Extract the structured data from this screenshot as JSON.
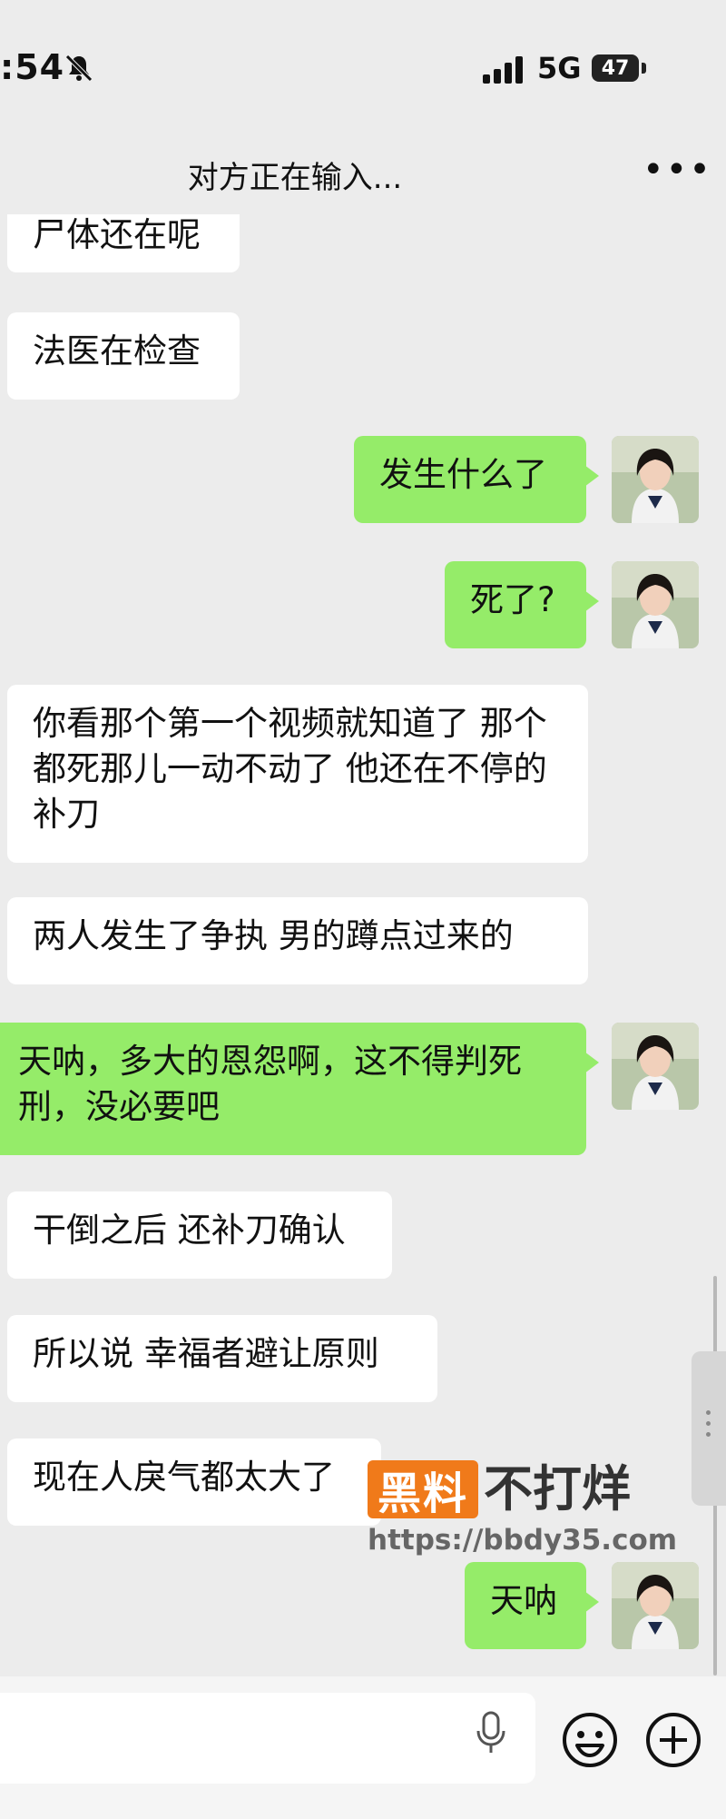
{
  "status": {
    "time": ":54",
    "network": "5G",
    "battery": "47"
  },
  "header": {
    "title": "对方正在输入...",
    "more_label": "•••"
  },
  "messages": [
    {
      "side": "in",
      "text": "尸体还在呢"
    },
    {
      "side": "in",
      "text": "法医在检查"
    },
    {
      "side": "out",
      "text": "发生什么了"
    },
    {
      "side": "out",
      "text": "死了?"
    },
    {
      "side": "in",
      "text": "你看那个第一个视频就知道了 那个都死那儿一动不动了  他还在不停的补刀"
    },
    {
      "side": "in",
      "text": "两人发生了争执  男的蹲点过来的"
    },
    {
      "side": "out",
      "text": "天呐，多大的恩怨啊，这不得判死刑，没必要吧"
    },
    {
      "side": "in",
      "text": "干倒之后 还补刀确认"
    },
    {
      "side": "in",
      "text": "所以说  幸福者避让原则"
    },
    {
      "side": "in",
      "text": "现在人戾气都太大了"
    },
    {
      "side": "out",
      "text": "天呐"
    }
  ],
  "watermark": {
    "box": "黑料",
    "text": "不打烊",
    "url": "https://bbdy35.com"
  },
  "colors": {
    "incoming": "#ffffff",
    "outgoing": "#95ec69",
    "background": "#ececec",
    "watermark": "#f07a1a"
  },
  "icons": [
    "mute-bell-icon",
    "signal-icon",
    "more-icon",
    "microphone-icon",
    "emoji-icon",
    "plus-icon"
  ]
}
